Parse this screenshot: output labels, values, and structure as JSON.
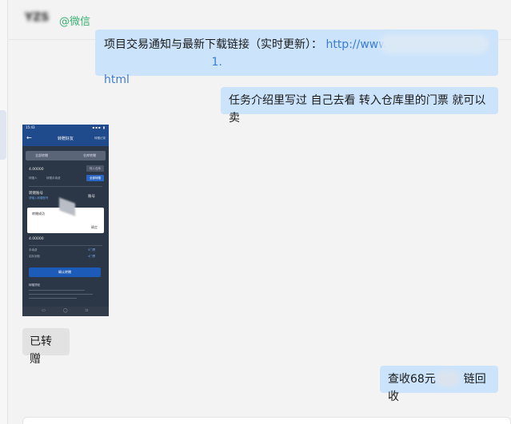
{
  "chat": {
    "contact_name": "YZS",
    "contact_tag": "@微信"
  },
  "messages": {
    "m1": {
      "text_before": "项目交易通知与最新下载链接（实时更新）：",
      "link_prefix": "http://www.",
      "link_suffix": "1.",
      "link_end": "html"
    },
    "m2": {
      "text": "任务介绍里写过  自己去看   转入仓库里的门票  就可以卖"
    },
    "m3": {
      "text": "已转赠"
    },
    "m4": {
      "text_a": "查收68元",
      "text_b": "链回收"
    }
  },
  "phone": {
    "time": "15:43",
    "status_icons": "▪▪▪ ▮",
    "back": "←",
    "title": "转赠好友",
    "top_right": "转赠记录",
    "tab_a": "全部转赠",
    "tab_b": "仓库转赠",
    "amount_top": "4.00000",
    "chip_1": "转赠人",
    "chip_2": "转赠手续费",
    "chip_3": "转赠数量",
    "btn_1": "转入仓库",
    "btn_2": "全部转赠",
    "row_a": "转赠账号",
    "row_a_sub": "请输入转赠账号",
    "row_b": "账号",
    "dialog_message": "转赠成功",
    "dialog_ok": "确定",
    "amount_bottom": "4.00000",
    "row_c": "手续费",
    "row_d": "实际到账",
    "row_c_val": "0门票",
    "row_d_val": "4门票",
    "confirm": "确认转赠",
    "notes_title": "转赠须知",
    "nav_left": "▭",
    "nav_mid": "◯",
    "nav_right": "⊐"
  },
  "colors": {
    "self_bubble": "#cce4fb",
    "peer_bubble": "#e2e2e2",
    "link": "#3a7bd5",
    "tag_green": "#3ab072"
  }
}
